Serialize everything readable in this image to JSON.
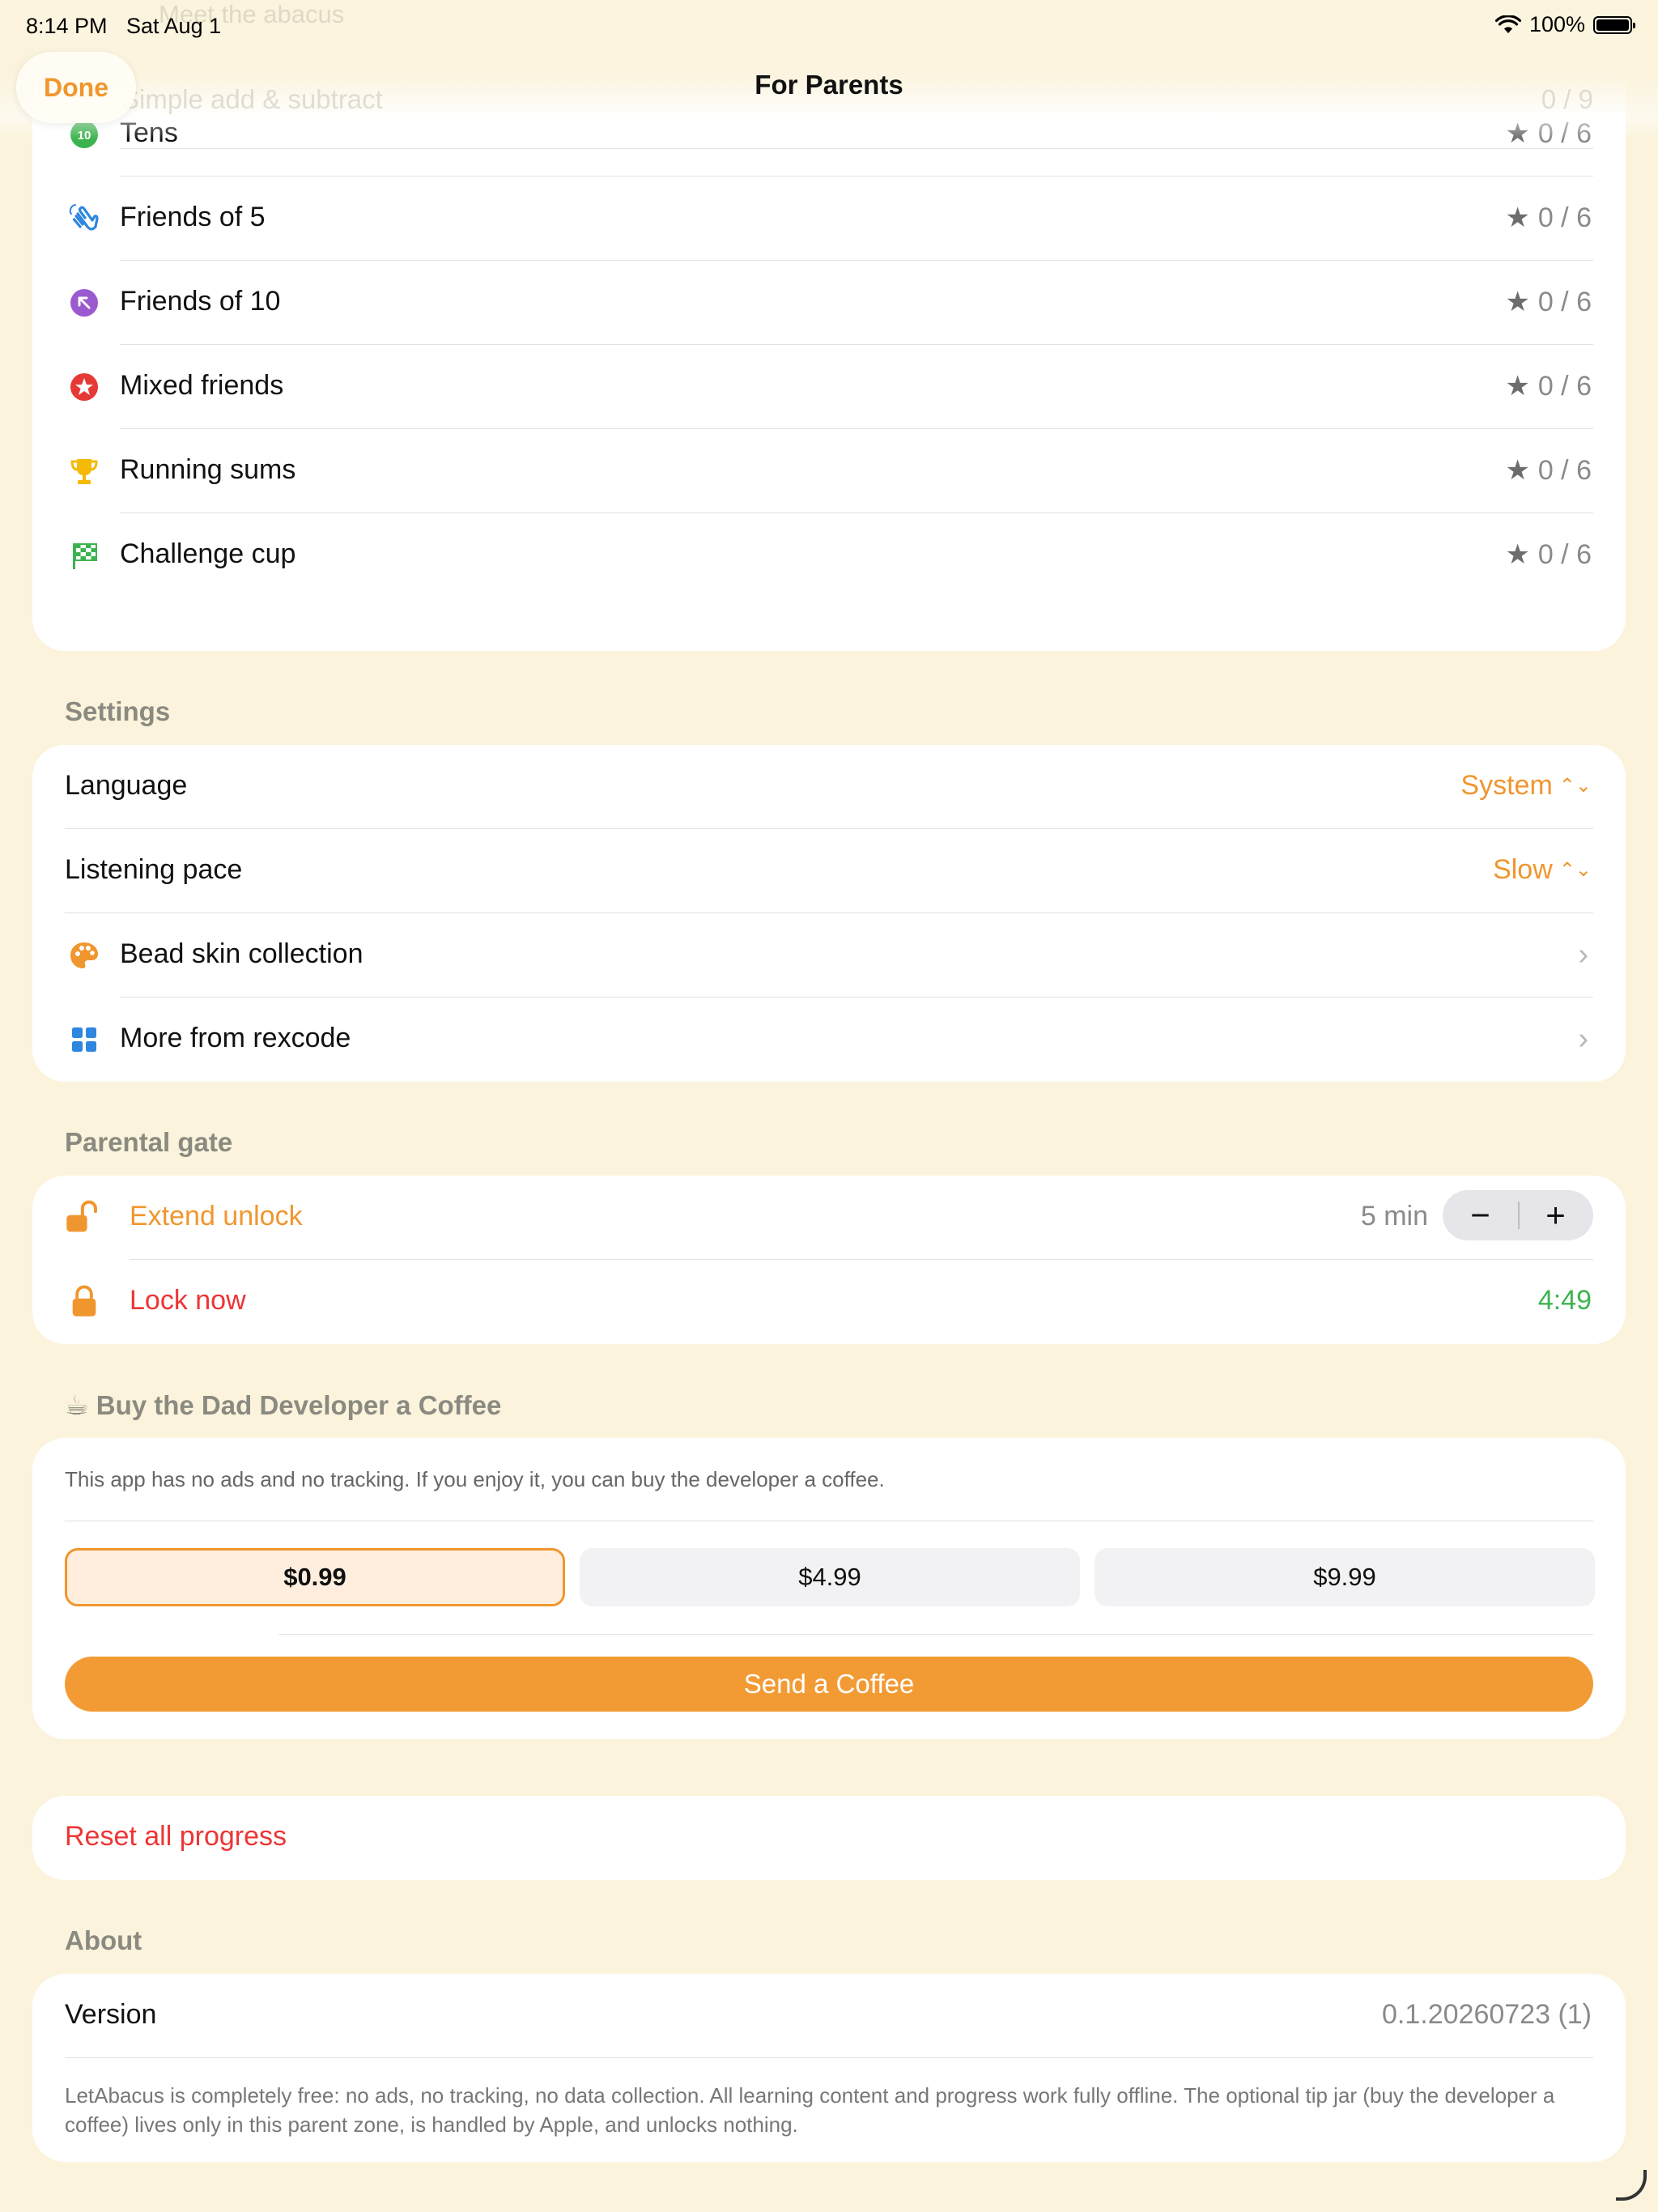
{
  "status_bar": {
    "time": "8:14 PM",
    "date": "Sat Aug 1",
    "battery": "100%"
  },
  "nav": {
    "done_label": "Done",
    "title": "For Parents"
  },
  "ghost": {
    "row1_label": "Meet the abacus",
    "row2_label": "Simple add & subtract",
    "row2_score": "0 / 9"
  },
  "lessons": [
    {
      "icon": "number-10-icon",
      "label": "Tens",
      "score": "0 / 6"
    },
    {
      "icon": "waving-hand-icon",
      "label": "Friends of 5",
      "score": "0 / 6"
    },
    {
      "icon": "arrow-up-left-circle-icon",
      "label": "Friends of 10",
      "score": "0 / 6"
    },
    {
      "icon": "star-circle-icon",
      "label": "Mixed friends",
      "score": "0 / 6"
    },
    {
      "icon": "trophy-icon",
      "label": "Running sums",
      "score": "0 / 6"
    },
    {
      "icon": "checkered-flag-icon",
      "label": "Challenge cup",
      "score": "0 / 6"
    }
  ],
  "settings": {
    "header": "Settings",
    "language_label": "Language",
    "language_value": "System",
    "pace_label": "Listening pace",
    "pace_value": "Slow",
    "bead_skin_label": "Bead skin collection",
    "more_label": "More from rexcode"
  },
  "gate": {
    "header": "Parental gate",
    "extend_label": "Extend unlock",
    "extend_value": "5 min",
    "minus_label": "−",
    "plus_label": "+",
    "lock_label": "Lock now",
    "countdown": "4:49"
  },
  "coffee": {
    "header": "☕ Buy the Dad Developer a Coffee",
    "description": "This app has no ads and no tracking. If you enjoy it, you can buy the developer a coffee.",
    "tips": [
      "$0.99",
      "$4.99",
      "$9.99"
    ],
    "selected_tip": "$0.99",
    "send_label": "Send a Coffee"
  },
  "reset": {
    "label": "Reset all progress"
  },
  "about": {
    "header": "About",
    "version_label": "Version",
    "version_value": "0.1.20260723 (1)",
    "note": "LetAbacus is completely free: no ads, no tracking, no data collection. All learning content and progress work fully offline. The optional tip jar (buy the developer a coffee) lives only in this parent zone, is handled by Apple, and unlocks nothing."
  },
  "colors": {
    "background": "#FBF3DC",
    "accent": "#F0962E",
    "danger": "#ED3535",
    "success": "#3DB34F"
  }
}
